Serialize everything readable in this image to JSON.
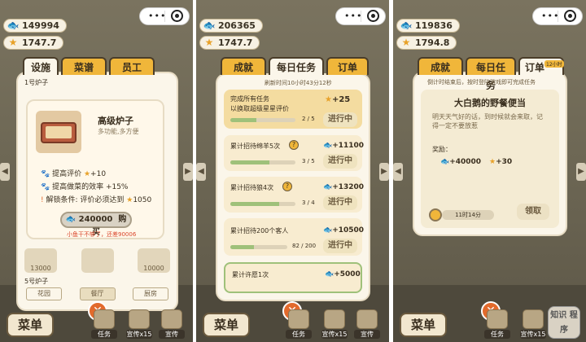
{
  "panel1": {
    "coins": "149994",
    "stars": "1747.7",
    "tabs": [
      "设施",
      "菜谱",
      "员工"
    ],
    "section_label": "1号炉子",
    "item_title": "高级炉子",
    "item_desc": "多功能,多方便",
    "bonus1": "提高评价",
    "bonus1_val": "+10",
    "bonus2": "提高做菜的效率 +15%",
    "bonus3": "解锁条件: 评价必须达到",
    "bonus3_val": "1050",
    "price": "240000",
    "buy": "购买",
    "warning": "小鱼干不够了，还差90006",
    "furnace_prices": [
      "13000",
      "",
      "10000"
    ],
    "section5": "5号炉子",
    "rooms": [
      "花园",
      "餐厅",
      "厨房"
    ],
    "menu": "菜单",
    "task": "任务",
    "promo": "宣传x15",
    "promo2": "宣传"
  },
  "panel2": {
    "coins": "206365",
    "stars": "1747.7",
    "tabs": [
      "成就",
      "每日任务",
      "订单"
    ],
    "refresh": "刷新时间10小时43分12秒",
    "tasks": [
      {
        "title": "完成所有任务",
        "sub": "以换取超级星星评价",
        "reward": "+25",
        "progress": "2 / 5",
        "btn": "进行中"
      },
      {
        "title": "累计招待绵羊5次",
        "sub": "",
        "reward": "+11100",
        "progress": "3 / 5",
        "btn": "进行中"
      },
      {
        "title": "累计招待狼4次",
        "sub": "",
        "reward": "+13200",
        "progress": "3 / 4",
        "btn": "进行中"
      },
      {
        "title": "累计招待200个客人",
        "sub": "",
        "reward": "+10500",
        "progress": "82 / 200",
        "btn": "进行中"
      },
      {
        "title": "累计许愿1次",
        "sub": "",
        "reward": "+5000",
        "progress": "",
        "btn": ""
      }
    ],
    "menu": "菜单",
    "task": "任务",
    "promo": "宣传x15",
    "promo2": "宣传"
  },
  "panel3": {
    "coins": "119836",
    "stars": "1794.8",
    "tabs": [
      "成就",
      "每日任务",
      "订单"
    ],
    "timer_badge": "12小时",
    "note": "倒计时结束后，按时登陆游戏即可完成任务",
    "order_title": "大白鹅的野餐便当",
    "order_text": "明天天气好的话，到时候就会来取，记得一定不要放惹",
    "reward_label": "奖励：",
    "reward_fish": "+40000",
    "reward_star": "+30",
    "countdown": "11时14分",
    "claim": "领取",
    "menu": "菜单",
    "task": "任务",
    "promo": "宣传x15",
    "miniapp": "知识 程序"
  }
}
